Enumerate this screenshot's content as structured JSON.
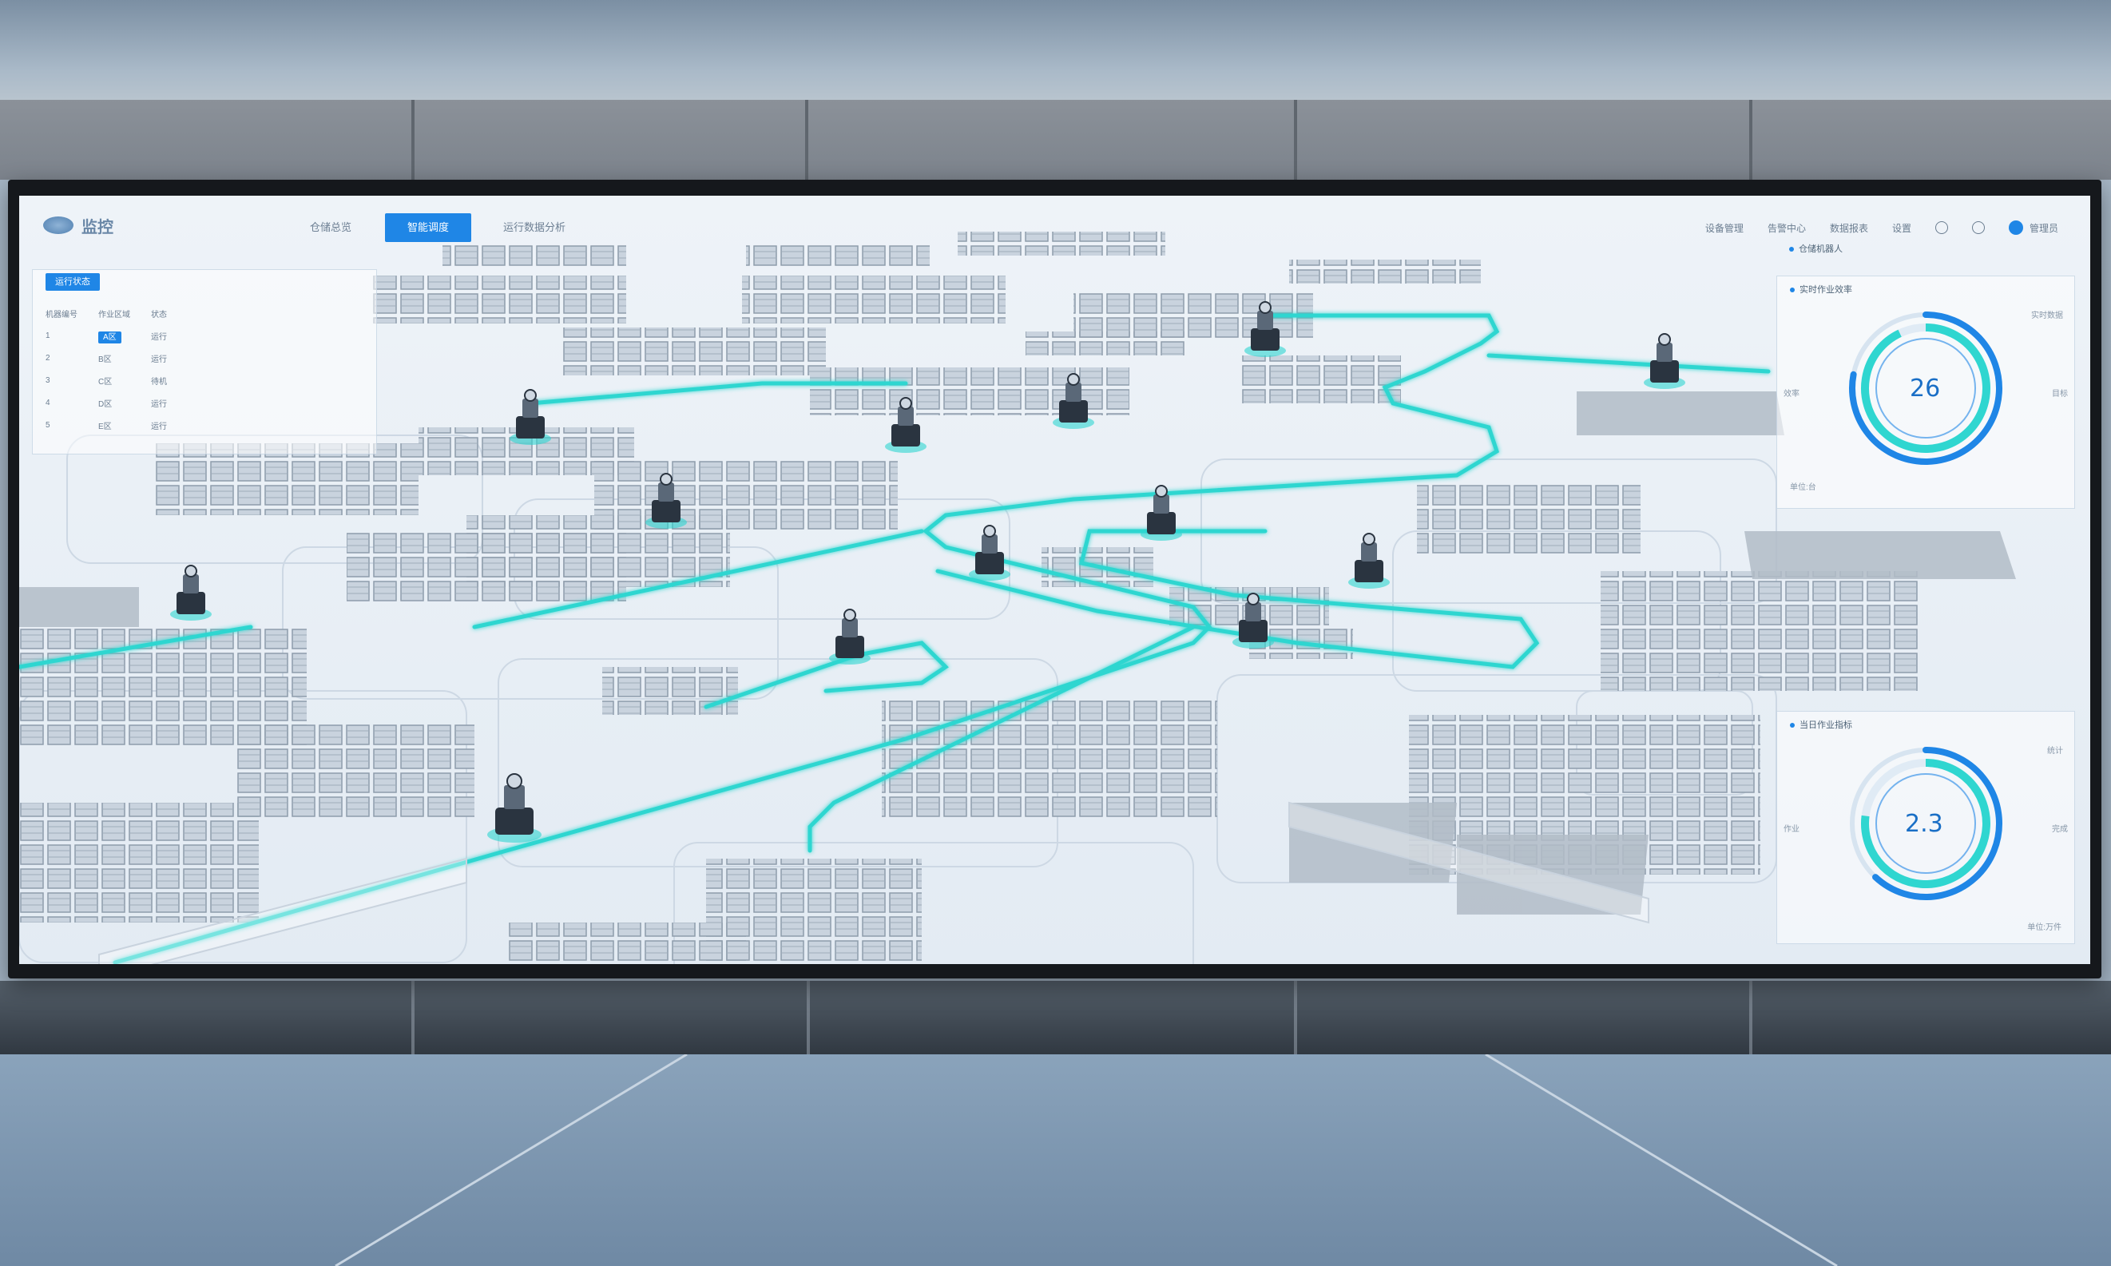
{
  "header": {
    "logo_text": "监控",
    "tabs": [
      "仓储总览",
      "智能调度",
      "运行数据分析"
    ],
    "active_tab_index": 1,
    "right_items": [
      "设备管理",
      "告警中心",
      "数据报表",
      "设置"
    ],
    "user_label": "管理员"
  },
  "left_panel": {
    "title": "运行状态",
    "columns": [
      "机器编号",
      "作业区域",
      "状态"
    ],
    "rows": [
      [
        "1",
        "A区",
        "运行"
      ],
      [
        "2",
        "B区",
        "运行"
      ],
      [
        "3",
        "C区",
        "待机"
      ],
      [
        "4",
        "D区",
        "运行"
      ],
      [
        "5",
        "E区",
        "运行"
      ]
    ]
  },
  "gauges": [
    {
      "title": "实时作业效率",
      "label": "仓储机器人",
      "value": "26",
      "fraction": 0.78,
      "side_left": "效率",
      "side_right": "目标",
      "legend_top": "实时数据",
      "legend_bottom": "单位:台"
    },
    {
      "title": "当日作业指标",
      "label": "",
      "value": "2.3",
      "fraction": 0.62,
      "side_left": "作业",
      "side_right": "完成",
      "legend_top": "统计",
      "legend_bottom": "单位:万件"
    }
  ],
  "colors": {
    "accent": "#1f86e6",
    "route": "#2fd6d0",
    "screen_bg": "#eaf0f6"
  }
}
